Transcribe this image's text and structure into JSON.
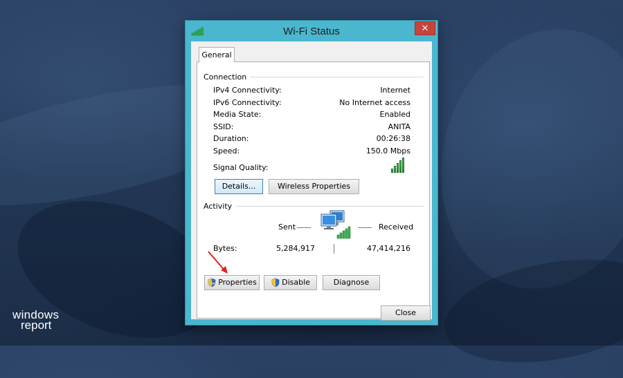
{
  "window": {
    "title": "Wi-Fi Status",
    "close_glyph": "✕"
  },
  "tabs": [
    {
      "label": "General",
      "selected": true
    }
  ],
  "connection": {
    "section_label": "Connection",
    "rows": [
      {
        "label": "IPv4 Connectivity:",
        "value": "Internet"
      },
      {
        "label": "IPv6 Connectivity:",
        "value": "No Internet access"
      },
      {
        "label": "Media State:",
        "value": "Enabled"
      },
      {
        "label": "SSID:",
        "value": "ANITA"
      },
      {
        "label": "Duration:",
        "value": "00:26:38"
      },
      {
        "label": "Speed:",
        "value": "150.0 Mbps"
      }
    ],
    "signal_label": "Signal Quality:",
    "signal_bars": 5,
    "details_button": "Details...",
    "wireless_properties_button": "Wireless Properties"
  },
  "activity": {
    "section_label": "Activity",
    "sent_label": "Sent",
    "received_label": "Received",
    "bytes_label": "Bytes:",
    "bytes_sent": "5,284,917",
    "bytes_received": "47,414,216"
  },
  "buttons": {
    "properties": "Properties",
    "disable": "Disable",
    "diagnose": "Diagnose",
    "close": "Close"
  },
  "icons": {
    "title": "wifi-signal-icon",
    "network": "network-computers-icon",
    "shield": "uac-shield-icon",
    "arrow": "red-arrow-annotation"
  },
  "colors": {
    "titlebar": "#4ab7cf",
    "close_button": "#c7433c",
    "signal_green": "#2fa33f",
    "arrow_red": "#e02020"
  },
  "watermark": {
    "line1": "windows",
    "line2": "report"
  }
}
